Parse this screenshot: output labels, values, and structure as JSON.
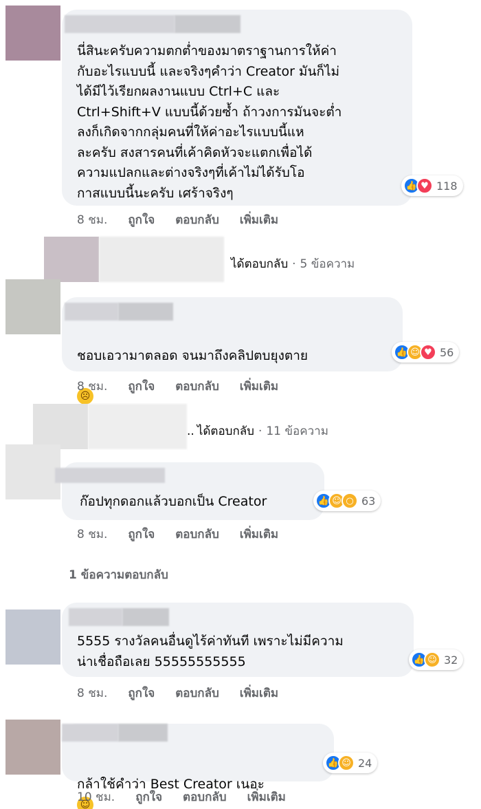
{
  "comments": [
    {
      "text": "นี่สินะครับความตกต่ำของมาตราฐานการให้ค่า\nกับอะไรแบบนี้ และจริงๆคำว่า Creator มันก็ไม่\nได้มีไว้เรียกผลงานแบบ Ctrl+C และ\nCtrl+Shift+V แบบนี้ด้วยซ้ำ ถ้าวงการมันจะต่ำ\nลงก็เกิดจากกลุ่มคนที่ให้ค่าอะไรแบบนี้แห\nละครับ สงสารคนที่เค้าคิดหัวจะแตกเพื่อได้\nความแปลกและต่างจริงๆที่เค้าไม่ได้รับโอ\nกาสแบบนี้นะครับ เศร้าจริงๆ",
      "reaction_icons": [
        "like-icon",
        "love-icon"
      ],
      "reaction_count": "118",
      "time": "8 ชม.",
      "like_label": "ถูกใจ",
      "reply_label": "ตอบกลับ",
      "more_label": "เพิ่มเติม"
    },
    {
      "text": "ชอบเอวามาตลอด จนมาถึงคลิปตบยุงตาย",
      "emoji": "crying-face",
      "reaction_icons": [
        "like-icon",
        "haha-icon",
        "love-icon"
      ],
      "reaction_count": "56",
      "time": "8 ชม.",
      "like_label": "ถูกใจ",
      "reply_label": "ตอบกลับ",
      "more_label": "เพิ่มเติม"
    },
    {
      "text": "ก๊อปทุกดอกแล้วบอกเป็น Creator",
      "reaction_icons": [
        "like-icon",
        "haha-icon",
        "wow-icon"
      ],
      "reaction_count": "63",
      "time": "8 ชม.",
      "like_label": "ถูกใจ",
      "reply_label": "ตอบกลับ",
      "more_label": "เพิ่มเติม"
    },
    {
      "text": "5555 รางวัลคนอื่นดูไร้ค่าทันที เพราะไม่มีความ\nน่าเชื่อถือเลย 55555555555",
      "reaction_icons": [
        "like-icon",
        "haha-icon"
      ],
      "reaction_count": "32",
      "time": "8 ชม.",
      "like_label": "ถูกใจ",
      "reply_label": "ตอบกลับ",
      "more_label": "เพิ่มเติม"
    },
    {
      "text": "กล้าใช้คำว่า Best Creator เนอะ",
      "emoji": "smirking-face",
      "reaction_icons": [
        "like-icon",
        "haha-icon"
      ],
      "reaction_count": "24",
      "time": "10 ชม.",
      "like_label": "ถูกใจ",
      "reply_label": "ตอบกลับ",
      "more_label": "เพิ่มเติม"
    }
  ],
  "reply_threads": [
    {
      "prefix": "",
      "replied": "ได้ตอบกลับ",
      "count": "5 ข้อความ"
    },
    {
      "prefix": "..",
      "replied": "ได้ตอบกลับ",
      "count": "11 ข้อความ"
    }
  ],
  "view_replies": "1 ข้อความตอบกลับ",
  "colors": {
    "bubble": "#f0f2f5",
    "like": "#1877f2",
    "love": "#f33e58",
    "haha": "#f7b125",
    "meta_text": "#65676b"
  }
}
